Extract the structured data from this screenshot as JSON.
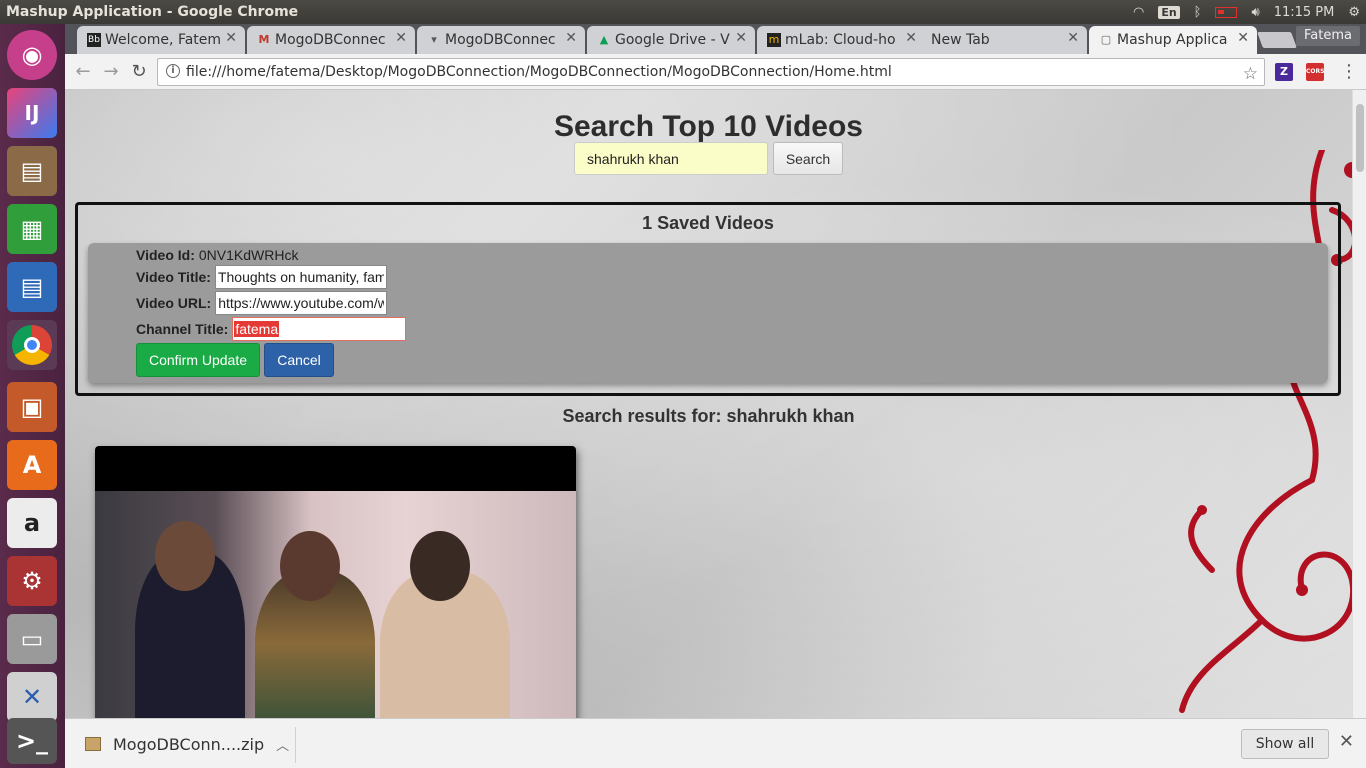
{
  "os": {
    "window_title": "Mashup Application - Google Chrome",
    "lang": "En",
    "clock": "11:15 PM"
  },
  "launcher": {
    "items": [
      "Ubuntu",
      "IJ",
      "Files",
      "Calc",
      "Writer",
      "Chrome",
      "Impress",
      "Software",
      "Amazon",
      "Settings",
      "Disk",
      "Remote",
      "Terminal"
    ]
  },
  "browser": {
    "tabs": [
      {
        "label": "Welcome, Fatem",
        "icon": "Bb"
      },
      {
        "label": "MogoDBConnec",
        "icon": "M"
      },
      {
        "label": "MogoDBConnec",
        "icon": "▾"
      },
      {
        "label": "Google Drive - V",
        "icon": "▲"
      },
      {
        "label": "mLab: Cloud-ho",
        "icon": "m"
      },
      {
        "label": "New Tab",
        "icon": ""
      },
      {
        "label": "Mashup Applica",
        "icon": "▢"
      }
    ],
    "profile": "Fatema",
    "url": "file:///home/fatema/Desktop/MogoDBConnection/MogoDBConnection/MogoDBConnection/Home.html",
    "extensions": {
      "z": "Z",
      "cors": "CORS"
    }
  },
  "page": {
    "title": "Search Top 10 Videos",
    "search": {
      "value": "shahrukh khan",
      "button": "Search"
    },
    "saved": {
      "heading": "1 Saved Videos",
      "video_id_label": "Video Id:",
      "video_id": "0NV1KdWRHck",
      "video_title_label": "Video Title:",
      "video_title": "Thoughts on humanity, fam",
      "video_url_label": "Video URL:",
      "video_url": "https://www.youtube.com/w",
      "channel_title_label": "Channel Title:",
      "channel_title": "fatema",
      "confirm": "Confirm Update",
      "cancel": "Cancel"
    },
    "results_heading": "Search results for: shahrukh khan"
  },
  "downloads": {
    "file": "MogoDBConn....zip",
    "show_all": "Show all"
  }
}
